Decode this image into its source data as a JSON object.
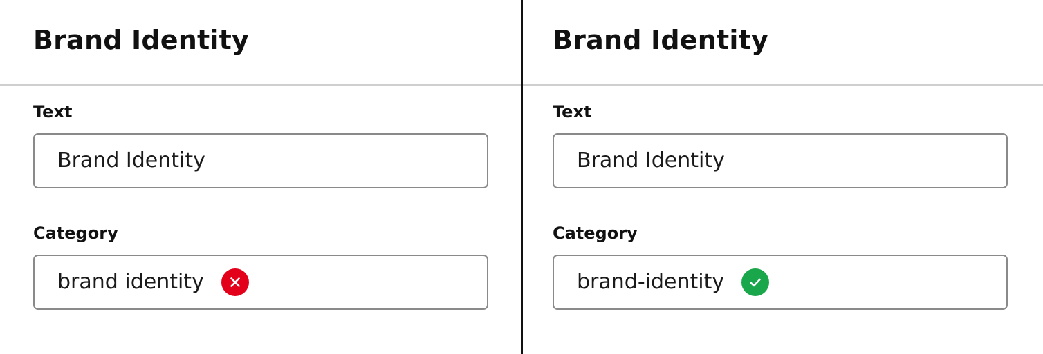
{
  "colors": {
    "error": "#e3001b",
    "success": "#1aa64a",
    "divider": "#cfcfcf",
    "border": "#8a8a8a",
    "text": "#111111"
  },
  "left_panel": {
    "title": "Brand Identity",
    "text_label": "Text",
    "text_value": "Brand Identity",
    "category_label": "Category",
    "category_value": "brand identity",
    "status_icon": "error-x-icon"
  },
  "right_panel": {
    "title": "Brand Identity",
    "text_label": "Text",
    "text_value": "Brand Identity",
    "category_label": "Category",
    "category_value": "brand-identity",
    "status_icon": "success-check-icon"
  }
}
